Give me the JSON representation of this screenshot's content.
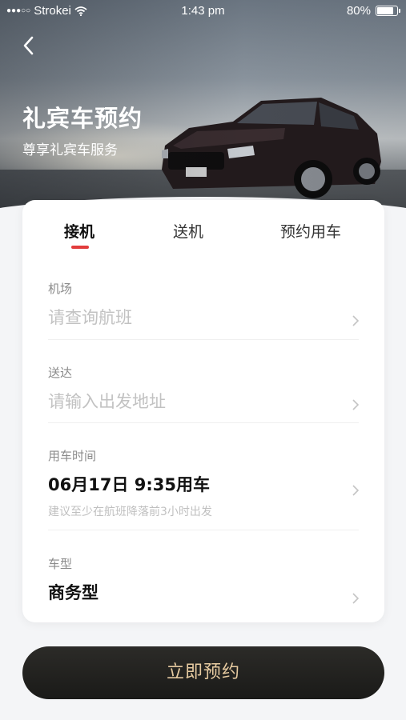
{
  "status_bar": {
    "signal": "●●●○○",
    "carrier": "Strokei",
    "time": "1:43 pm",
    "battery": "80%",
    "battery_level": 0.8
  },
  "header": {
    "title": "礼宾车预约",
    "subtitle": "尊享礼宾车服务"
  },
  "tabs": [
    {
      "label": "接机",
      "active": true
    },
    {
      "label": "送机",
      "active": false
    },
    {
      "label": "预约用车",
      "active": false
    }
  ],
  "form": {
    "airport": {
      "label": "机场",
      "placeholder": "请查询航班"
    },
    "destination": {
      "label": "送达",
      "placeholder": "请输入出发地址"
    },
    "time": {
      "label": "用车时间",
      "value": "06月17日  9:35用车",
      "hint": "建议至少在航班降落前3小时出发"
    },
    "car_type": {
      "label": "车型",
      "value": "商务型"
    }
  },
  "actions": {
    "book_label": "立即预约"
  },
  "colors": {
    "accent": "#e23c3c",
    "button_bg": "#1f1f1d",
    "button_text": "#e6caa0"
  }
}
